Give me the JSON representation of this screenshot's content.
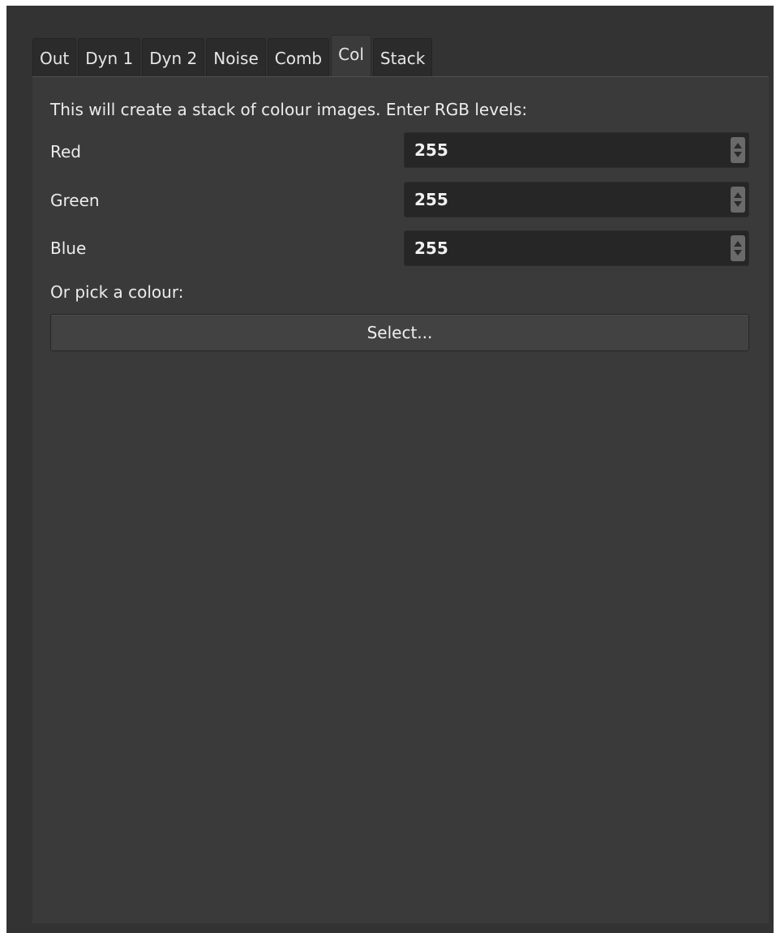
{
  "tabs": [
    {
      "label": "Out"
    },
    {
      "label": "Dyn 1"
    },
    {
      "label": "Dyn 2"
    },
    {
      "label": "Noise"
    },
    {
      "label": "Comb"
    },
    {
      "label": "Col",
      "active": true
    },
    {
      "label": "Stack"
    }
  ],
  "panel": {
    "intro": "This will create a stack of colour images. Enter RGB levels:",
    "red": {
      "label": "Red",
      "value": "255"
    },
    "green": {
      "label": "Green",
      "value": "255"
    },
    "blue": {
      "label": "Blue",
      "value": "255"
    },
    "pick_label": "Or pick a colour:",
    "select_label": "Select..."
  },
  "colors": {
    "background": "#333333",
    "panel": "#3a3a3a",
    "input": "#262626",
    "text": "#ececec"
  }
}
